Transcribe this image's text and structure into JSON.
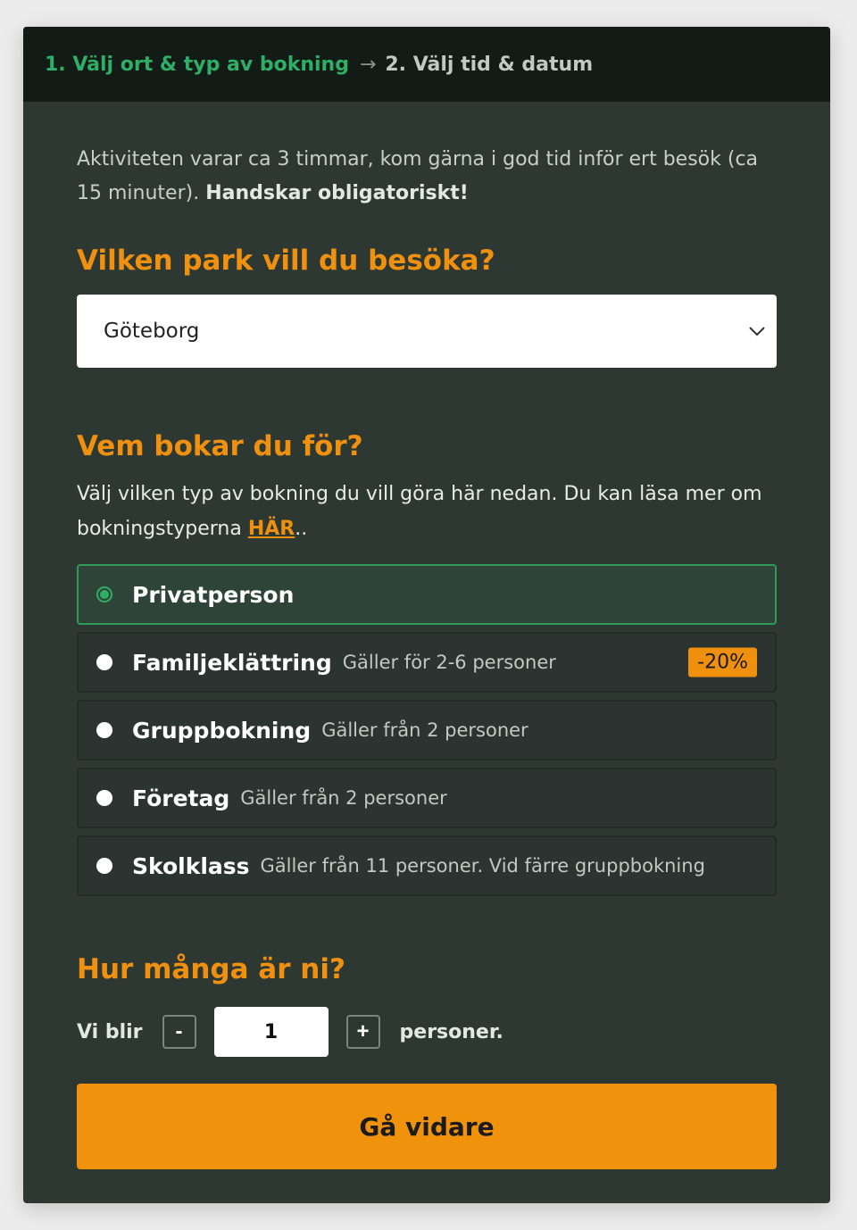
{
  "steps": {
    "step1": "1. Välj ort & typ av bokning",
    "arrow": "→",
    "step2": "2. Välj tid & datum"
  },
  "intro": {
    "text": "Aktiviteten varar ca 3 timmar, kom gärna i god tid inför ert besök (ca 15 minuter).",
    "bold": "Handskar obligatoriskt!"
  },
  "park": {
    "heading": "Vilken park vill du besöka?",
    "selected": "Göteborg"
  },
  "who": {
    "heading": "Vem bokar du för?",
    "desc": "Välj vilken typ av bokning du vill göra här nedan. Du kan läsa mer om bokningstyperna",
    "link": "HÄR",
    "after_link": "..",
    "options": [
      {
        "label": "Privatperson",
        "sub": "",
        "selected": true
      },
      {
        "label": "Familjeklättring",
        "sub": "Gäller för 2-6 personer",
        "badge": "-20%"
      },
      {
        "label": "Gruppbokning",
        "sub": "Gäller från 2 personer"
      },
      {
        "label": "Företag",
        "sub": "Gäller från 2 personer"
      },
      {
        "label": "Skolklass",
        "sub": "Gäller från 11 personer. Vid färre gruppbokning"
      }
    ]
  },
  "count": {
    "heading": "Hur många är ni?",
    "prefix": "Vi blir",
    "minus": "-",
    "value": "1",
    "plus": "+",
    "suffix": "personer."
  },
  "submit": {
    "label": "Gå vidare"
  },
  "colors": {
    "accent": "#f0900f",
    "active_step": "#2fae66",
    "panel": "#2e3833"
  }
}
